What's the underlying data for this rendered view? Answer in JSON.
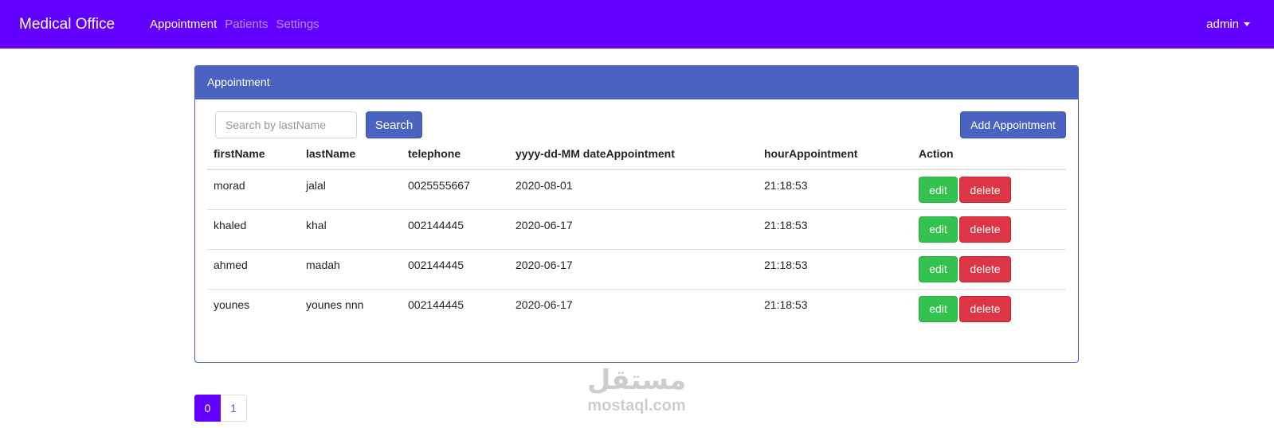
{
  "navbar": {
    "brand": "Medical Office",
    "links": [
      {
        "label": "Appointment",
        "active": true
      },
      {
        "label": "Patients",
        "active": false
      },
      {
        "label": "Settings",
        "active": false
      }
    ],
    "user": "admin"
  },
  "card": {
    "title": "Appointment",
    "search_placeholder": "Search by lastName",
    "search_label": "Search",
    "add_label": "Add Appointment"
  },
  "table": {
    "headers": [
      "firstName",
      "lastName",
      "telephone",
      "yyyy-dd-MM dateAppointment",
      "hourAppointment",
      "Action"
    ],
    "rows": [
      {
        "firstName": "morad",
        "lastName": "jalal",
        "telephone": "0025555667",
        "date": "2020-08-01",
        "hour": "21:18:53"
      },
      {
        "firstName": "khaled",
        "lastName": "khal",
        "telephone": "002144445",
        "date": "2020-06-17",
        "hour": "21:18:53"
      },
      {
        "firstName": "ahmed",
        "lastName": "madah",
        "telephone": "002144445",
        "date": "2020-06-17",
        "hour": "21:18:53"
      },
      {
        "firstName": "younes",
        "lastName": "younes nnn",
        "telephone": "002144445",
        "date": "2020-06-17",
        "hour": "21:18:53"
      }
    ],
    "edit_label": "edit",
    "delete_label": "delete"
  },
  "pagination": {
    "pages": [
      "0",
      "1"
    ],
    "active": "0"
  },
  "watermark": {
    "arabic": "مستقل",
    "latin": "mostaql.com"
  },
  "colors": {
    "navbar": "#6200ff",
    "primary": "#4a63c0",
    "success": "#33c24d",
    "danger": "#dc3545"
  }
}
